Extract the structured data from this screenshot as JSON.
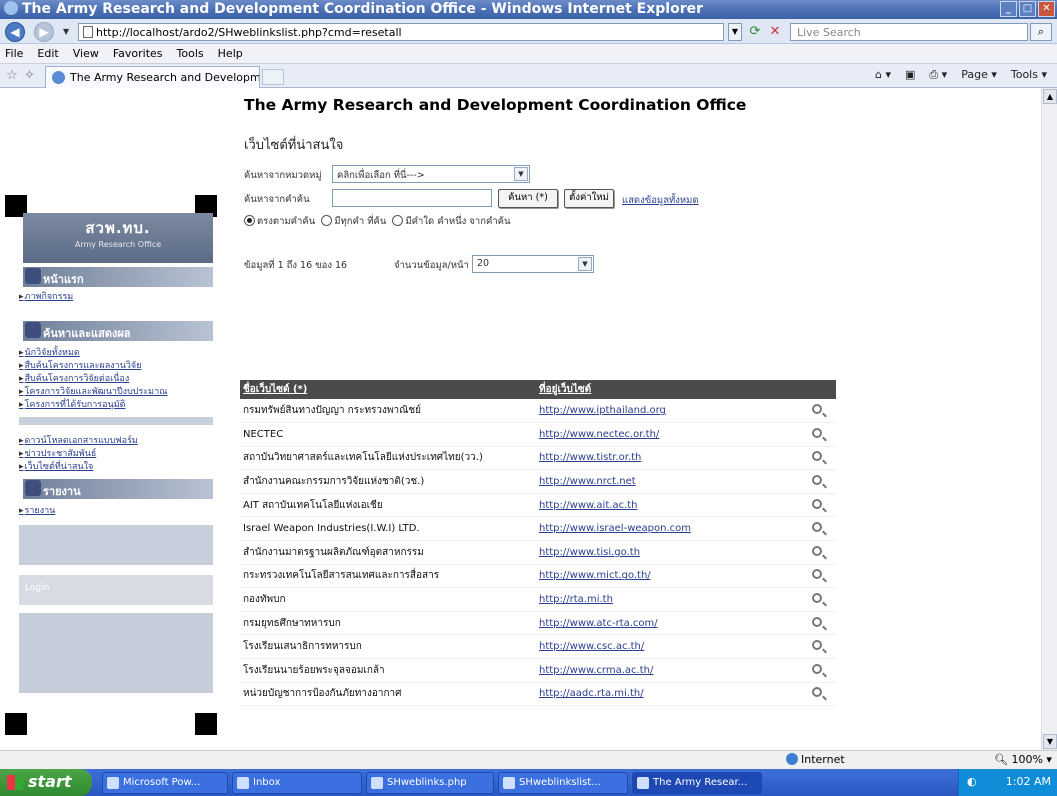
{
  "window": {
    "title": "The Army Research and Development Coordination Office - Windows Internet Explorer"
  },
  "address": {
    "url": "http://localhost/ardo2/SHweblinkslist.php?cmd=resetall",
    "search_placeholder": "Live Search"
  },
  "menu": [
    "File",
    "Edit",
    "View",
    "Favorites",
    "Tools",
    "Help"
  ],
  "tab": {
    "label": "The Army Research and Development Coordi..."
  },
  "cmdbar": {
    "page": "Page ▾",
    "tools": "Tools ▾"
  },
  "page": {
    "title": "The Army Research and Development Coordination Office",
    "subtitle": "เว็บไซต์ที่น่าสนใจ"
  },
  "left_menu": {
    "header": "สวพ.ทบ.",
    "header_sub": "Army Research Office",
    "home": "หน้าแรก",
    "home_links": [
      "ภาพกิจกรรม"
    ],
    "section_search": "ค้นหาและแสดงผล",
    "search_links": [
      "นักวิจัยทั้งหมด",
      "สืบค้นโครงการและผลงานวิจัย",
      "สืบค้นโครงการวิจัยต่อเนื่อง",
      "โครงการวิจัยและพัฒนาปีงบประมาณ",
      "โครงการที่ได้รับการอนุมัติ"
    ],
    "other_links": [
      "ดาวน์โหลดเอกสารแบบฟอร์ม",
      "ข่าวประชาสัมพันธ์",
      "เว็บไซต์ที่น่าสนใจ"
    ],
    "section_report": "รายงาน",
    "report_links": [
      "รายงาน"
    ],
    "footer": "Login"
  },
  "search_form": {
    "category_label": "ค้นหาจากหมวดหมู่",
    "category_value": "คลิกเพื่อเลือก ที่นี่--->",
    "keyword_label": "ค้นหาจากคำค้น",
    "keyword_value": "",
    "search_button": "ค้นหา (*)",
    "reset_button": "ตั้งค่าใหม่",
    "show_all_link": "แสดงข้อมูลทั้งหมด",
    "radio_options": [
      "ตรงตามคำค้น",
      "มีทุกคำ ที่ค้น",
      "มีคำใด คำหนึ่ง จากคำค้น"
    ],
    "radio_selected": 0,
    "records_text": "ข้อมูลที่ 1 ถึง 16 ของ 16",
    "per_page_label": "จำนวนข้อมูล/หน้า",
    "per_page_value": "20"
  },
  "table": {
    "columns": [
      "ชื่อเว็บไซต์ (*)",
      "ที่อยู่เว็บไซต์"
    ],
    "rows": [
      {
        "name": "กรมทรัพย์สินทางปัญญา กระทรวงพาณิชย์",
        "url": "http://www.ipthailand.org"
      },
      {
        "name": "NECTEC",
        "url": "http://www.nectec.or.th/"
      },
      {
        "name": "สถาบันวิทยาศาสตร์และเทคโนโลยีแห่งประเทศไทย(วว.)",
        "url": "http://www.tistr.or.th"
      },
      {
        "name": "สำนักงานคณะกรรมการวิจัยแห่งชาติ(วช.)",
        "url": "http://www.nrct.net"
      },
      {
        "name": "AIT สถาบันเทคโนโลยีแห่งเอเชีย",
        "url": "http://www.ait.ac.th"
      },
      {
        "name": "Israel Weapon Industries(I.W.I) LTD.",
        "url": "http://www.israel-weapon.com"
      },
      {
        "name": "สำนักงานมาตรฐานผลิตภัณฑ์อุตสาหกรรม",
        "url": "http://www.tisi.go.th"
      },
      {
        "name": "กระทรวงเทคโนโลยีสารสนเทศและการสื่อสาร",
        "url": "http://www.mict.go.th/"
      },
      {
        "name": "กองทัพบก",
        "url": "http://rta.mi.th"
      },
      {
        "name": "กรมยุทธศึกษาทหารบก",
        "url": "http://www.atc-rta.com/"
      },
      {
        "name": "โรงเรียนเสนาธิการทหารบก",
        "url": "http://www.csc.ac.th/"
      },
      {
        "name": "โรงเรียนนายร้อยพระจุลจอมเกล้า",
        "url": "http://www.crma.ac.th/"
      },
      {
        "name": "หน่วยบัญชาการป้องกันภัยทางอากาศ",
        "url": "http://aadc.rta.mi.th/"
      }
    ]
  },
  "status": {
    "zone": "Internet",
    "zoom": "100%"
  },
  "taskbar": {
    "start": "start",
    "tasks": [
      "Microsoft Pow...",
      "Inbox",
      "SHweblinks.php",
      "SHweblinkslist...",
      "The Army Resear..."
    ],
    "active_task": 4,
    "clock": "1:02 AM"
  }
}
